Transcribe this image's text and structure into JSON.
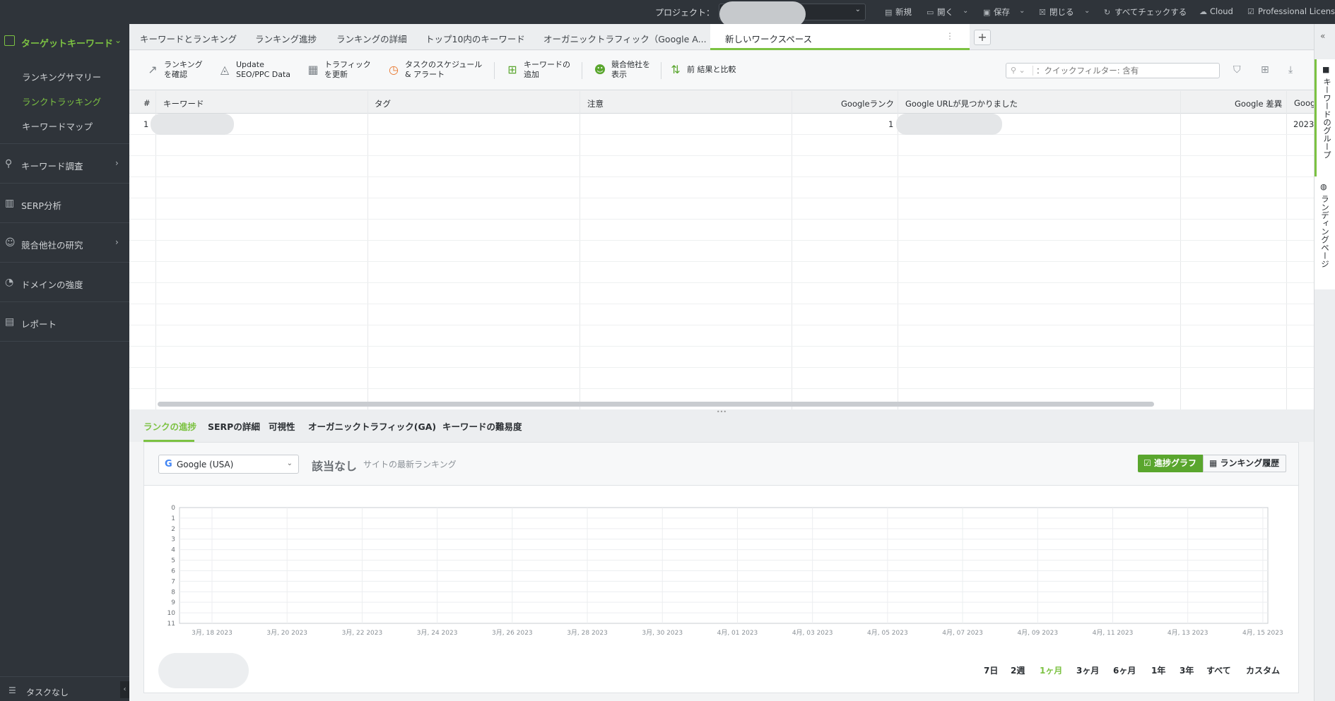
{
  "topbar": {
    "project_label": "プロジェクト：",
    "items": [
      {
        "name": "new",
        "icon": "new-file-icon",
        "label": "新規"
      },
      {
        "name": "open",
        "icon": "folder-icon",
        "label": "開く"
      },
      {
        "name": "save",
        "icon": "save-icon",
        "label": "保存"
      },
      {
        "name": "close",
        "icon": "close-icon",
        "label": "閉じる"
      },
      {
        "name": "check-all",
        "icon": "refresh-icon",
        "label": "すべてチェックする"
      },
      {
        "name": "cloud",
        "icon": "cloud-icon",
        "label": "Cloud"
      },
      {
        "name": "license",
        "icon": "checkbox-icon",
        "label": "Professional License"
      }
    ]
  },
  "sidebar": {
    "header": "ターゲットキーワード",
    "sub_items": [
      "ランキングサマリー",
      "ランクトラッキング",
      "キーワードマップ"
    ],
    "active_sub": 1,
    "sections": [
      {
        "label": "キーワード調査",
        "icon": "search-icon",
        "has_arrow": true
      },
      {
        "label": "SERP分析",
        "icon": "bar-chart-icon",
        "has_arrow": false
      },
      {
        "label": "競合他社の研究",
        "icon": "user-icon",
        "has_arrow": true
      },
      {
        "label": "ドメインの強度",
        "icon": "gauge-icon",
        "has_arrow": false
      },
      {
        "label": "レポート",
        "icon": "document-icon",
        "has_arrow": false
      }
    ],
    "tasks": "タスクなし"
  },
  "tabs": [
    "キーワードとランキング",
    "ランキング進捗",
    "ランキングの詳細",
    "トップ10内のキーワード",
    "オーガニックトラフィック（Google A...",
    "新しいワークスペース"
  ],
  "active_tab": 5,
  "right_rail": {
    "tab1": "キーワードのグループ",
    "tab2": "ランディングページ"
  },
  "toolbar": {
    "buttons": [
      {
        "name": "check-rankings",
        "icon": "check-rankings-icon",
        "label": "ランキング\nを確認"
      },
      {
        "name": "update-seo-ppc",
        "icon": "update-icon",
        "label": "Update\nSEO/PPC Data"
      },
      {
        "name": "update-traffic",
        "icon": "traffic-icon",
        "label": "トラフィック\nを更新"
      },
      {
        "name": "schedule-tasks",
        "icon": "schedule-icon",
        "label": "タスクのスケジュール\n& アラート"
      },
      {
        "name": "add-keywords",
        "icon": "add-icon",
        "label": "キーワードの\n追加"
      },
      {
        "name": "show-competitors",
        "icon": "competitors-icon",
        "label": "競合他社を\n表示"
      },
      {
        "name": "compare-results",
        "icon": "compare-icon",
        "label": "前 結果と比較"
      }
    ],
    "quick_filter_placeholder": "：クイックフィルター: 含有"
  },
  "grid": {
    "columns": [
      "#",
      "キーワード",
      "タグ",
      "注意",
      "Googleランク",
      "Google URLが見つかりました",
      "Google 差異",
      "Goog"
    ],
    "rows": [
      {
        "num": "1",
        "rank": "1",
        "date_partial": "2023"
      }
    ]
  },
  "bottom_tabs": [
    "ランクの進捗",
    "SERPの詳細",
    "可視性",
    "オーガニックトラフィック(GA)",
    "キーワードの難易度"
  ],
  "active_bottom_tab": 0,
  "panel": {
    "search_engine": "Google (USA)",
    "status": "該当なし",
    "status_sub": "サイトの最新ランキング",
    "btn_graph": "進捗グラフ",
    "btn_history": "ランキング履歴",
    "periods": [
      "7日",
      "2週",
      "1ヶ月",
      "3ヶ月",
      "6ヶ月",
      "1年",
      "3年",
      "すべて",
      "カスタム"
    ],
    "active_period": 2
  },
  "chart_data": {
    "type": "line",
    "y_ticks": [
      "0",
      "1",
      "2",
      "3",
      "4",
      "5",
      "6",
      "7",
      "8",
      "9",
      "10",
      "11"
    ],
    "x_ticks": [
      "3月, 18 2023",
      "3月, 20 2023",
      "3月, 22 2023",
      "3月, 24 2023",
      "3月, 26 2023",
      "3月, 28 2023",
      "3月, 30 2023",
      "4月, 01 2023",
      "4月, 03 2023",
      "4月, 05 2023",
      "4月, 07 2023",
      "4月, 09 2023",
      "4月, 11 2023",
      "4月, 13 2023",
      "4月, 15 2023"
    ],
    "ylim": [
      0,
      11
    ],
    "series": [],
    "grid": true
  },
  "colors": {
    "accent": "#7cc242",
    "sidebar_bg": "#2f343a",
    "button_green": "#5aa62e"
  }
}
